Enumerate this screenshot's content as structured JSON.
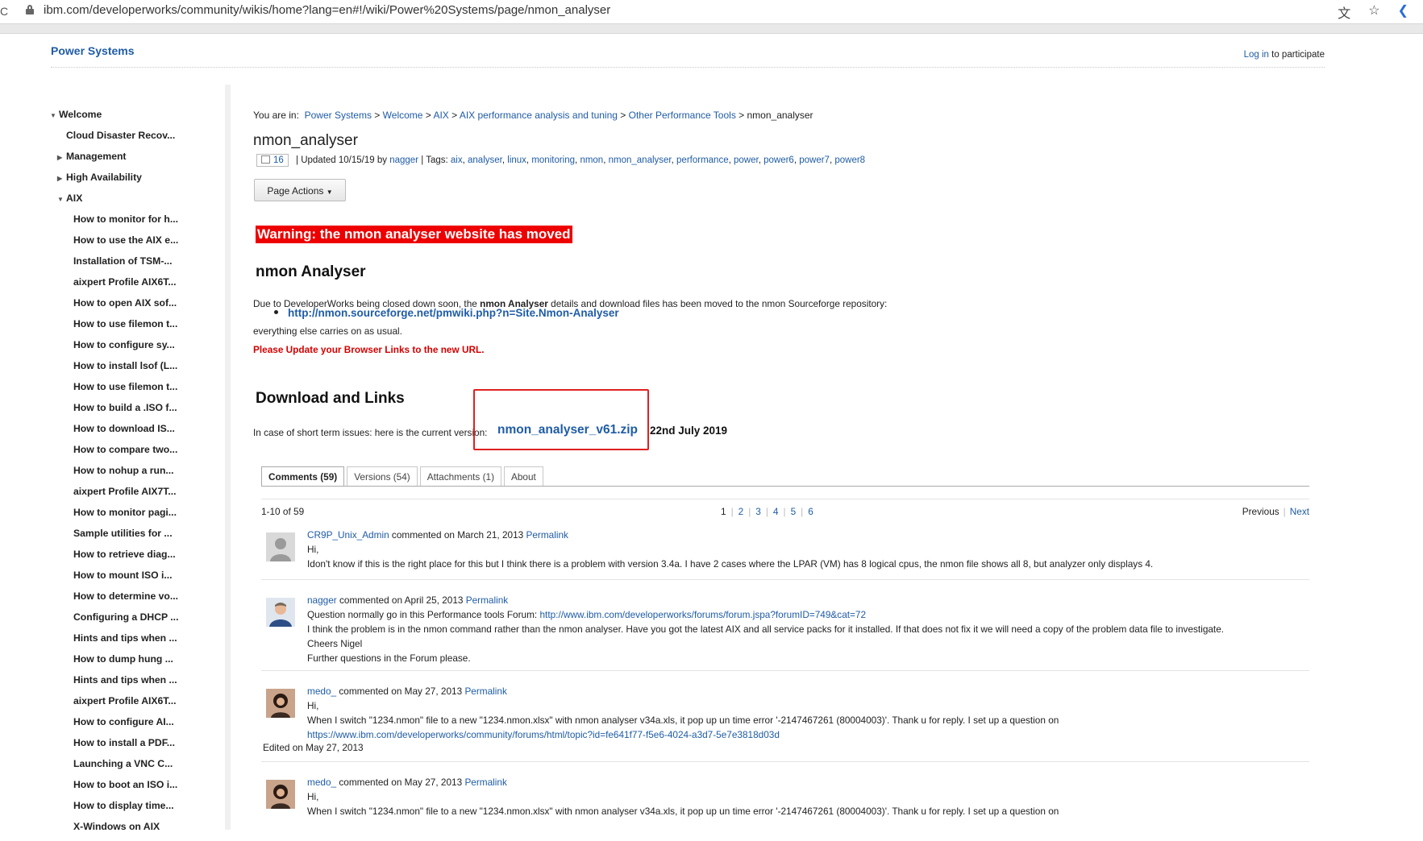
{
  "browser": {
    "url": "ibm.com/developerworks/community/wikis/home?lang=en#!/wiki/Power%20Systems/page/nmon_analyser"
  },
  "header": {
    "site_title": "Power Systems",
    "login_link": "Log in",
    "login_suffix": " to participate"
  },
  "nav": {
    "items": [
      {
        "label": "Welcome",
        "level": 0,
        "toggle": "open"
      },
      {
        "label": "Cloud Disaster Recov...",
        "level": 1,
        "toggle": "none"
      },
      {
        "label": "Management",
        "level": 1,
        "toggle": "closed"
      },
      {
        "label": "High Availability",
        "level": 1,
        "toggle": "closed"
      },
      {
        "label": "AIX",
        "level": 1,
        "toggle": "open"
      },
      {
        "label": "How to monitor for h...",
        "level": 2,
        "toggle": "none"
      },
      {
        "label": "How to use the AIX e...",
        "level": 2,
        "toggle": "none"
      },
      {
        "label": "Installation of TSM-...",
        "level": 2,
        "toggle": "none"
      },
      {
        "label": "aixpert Profile AIX6T...",
        "level": 2,
        "toggle": "none"
      },
      {
        "label": "How to open AIX sof...",
        "level": 2,
        "toggle": "none"
      },
      {
        "label": "How to use filemon t...",
        "level": 2,
        "toggle": "none"
      },
      {
        "label": "How to configure sy...",
        "level": 2,
        "toggle": "none"
      },
      {
        "label": "How to install lsof (L...",
        "level": 2,
        "toggle": "none"
      },
      {
        "label": "How to use filemon t...",
        "level": 2,
        "toggle": "none"
      },
      {
        "label": "How to build a .ISO f...",
        "level": 2,
        "toggle": "none"
      },
      {
        "label": "How to download IS...",
        "level": 2,
        "toggle": "none"
      },
      {
        "label": "How to compare two...",
        "level": 2,
        "toggle": "none"
      },
      {
        "label": "How to nohup a run...",
        "level": 2,
        "toggle": "none"
      },
      {
        "label": "aixpert Profile AIX7T...",
        "level": 2,
        "toggle": "none"
      },
      {
        "label": "How to monitor pagi...",
        "level": 2,
        "toggle": "none"
      },
      {
        "label": "Sample utilities for ...",
        "level": 2,
        "toggle": "none"
      },
      {
        "label": "How to retrieve diag...",
        "level": 2,
        "toggle": "none"
      },
      {
        "label": "How to mount ISO i...",
        "level": 2,
        "toggle": "none"
      },
      {
        "label": "How to determine vo...",
        "level": 2,
        "toggle": "none"
      },
      {
        "label": "Configuring a DHCP ...",
        "level": 2,
        "toggle": "none"
      },
      {
        "label": "Hints and tips when ...",
        "level": 2,
        "toggle": "none"
      },
      {
        "label": "How to dump hung ...",
        "level": 2,
        "toggle": "none"
      },
      {
        "label": "Hints and tips when ...",
        "level": 2,
        "toggle": "none"
      },
      {
        "label": "aixpert Profile AIX6T...",
        "level": 2,
        "toggle": "none"
      },
      {
        "label": "How to configure AI...",
        "level": 2,
        "toggle": "none"
      },
      {
        "label": "How to install a PDF...",
        "level": 2,
        "toggle": "none"
      },
      {
        "label": "Launching a VNC C...",
        "level": 2,
        "toggle": "none"
      },
      {
        "label": "How to boot an ISO i...",
        "level": 2,
        "toggle": "none"
      },
      {
        "label": "How to display time...",
        "level": 2,
        "toggle": "none"
      },
      {
        "label": "X-Windows on AIX",
        "level": 2,
        "toggle": "none"
      }
    ]
  },
  "breadcrumb": {
    "prefix": "You are in:",
    "links": [
      "Power Systems",
      "Welcome",
      "AIX",
      "AIX performance analysis and tuning",
      "Other Performance Tools"
    ],
    "current": "nmon_analyser",
    "separator": ">"
  },
  "page": {
    "title": "nmon_analyser",
    "likes": "16",
    "updated": "Updated 10/15/19 by",
    "author": "nagger",
    "tags_label": "Tags:",
    "tags": [
      "aix",
      "analyser",
      "linux",
      "monitoring",
      "nmon",
      "nmon_analyser",
      "performance",
      "power",
      "power6",
      "power7",
      "power8"
    ],
    "page_actions": "Page Actions"
  },
  "content": {
    "warning": "Warning: the nmon analyser website has moved",
    "heading1": "nmon Analyser",
    "moved_prefix": "Due to DeveloperWorks being closed down soon, the ",
    "moved_bold": "nmon Analyser",
    "moved_suffix": " details and download files has been moved to the nmon Sourceforge repository:",
    "sourceforge_link": "http://nmon.sourceforge.net/pmwiki.php?n=Site.Nmon-Analyser",
    "carries_on": "everything else carries on as usual.",
    "update_links": "Please Update your Browser Links to the new URL.",
    "heading2": "Download and Links",
    "short_term": "In case of short term issues: here is the current version:",
    "zip_link": "nmon_analyser_v61.zip",
    "zip_date": "22nd July 2019"
  },
  "tabs": [
    "Comments (59)",
    "Versions (54)",
    "Attachments (1)",
    "About"
  ],
  "pager": {
    "count": "1-10 of 59",
    "pages": [
      "1",
      "2",
      "3",
      "4",
      "5",
      "6"
    ],
    "previous": "Previous",
    "next": "Next"
  },
  "comments": [
    {
      "author": "CR9P_Unix_Admin",
      "meta": " commented on March 21, 2013 ",
      "permalink": "Permalink",
      "lines": [
        {
          "text": "Hi,"
        },
        {
          "text": "Idon't know if this is the right place for this but I think there is a problem with version 3.4a. I have 2 cases where the LPAR (VM) has 8 logical cpus, the nmon file shows all 8, but analyzer only displays 4."
        }
      ]
    },
    {
      "author": "nagger",
      "meta": " commented on April 25, 2013 ",
      "permalink": "Permalink",
      "lines": [
        {
          "text": "Question normally go in this Performance tools Forum: ",
          "link": "http://www.ibm.com/developerworks/forums/forum.jspa?forumID=749&cat=72"
        },
        {
          "text": "I think the problem is in the nmon command rather than the nmon analyser. Have you got the latest AIX and all service packs for it installed.  If that does not fix it we will need a copy of the problem data file to investigate."
        },
        {
          "text": "Cheers Nigel"
        },
        {
          "text": "Further questions in the Forum please."
        }
      ]
    },
    {
      "author": "medo_",
      "meta": " commented on May 27, 2013 ",
      "permalink": "Permalink",
      "lines": [
        {
          "text": "Hi,"
        },
        {
          "text": "When I switch \"1234.nmon\" file to a new \"1234.nmon.xlsx\" with nmon analyser v34a.xls, it pop up un time error '-2147467261 (80004003)'. Thank u for reply. I set up a question on"
        },
        {
          "text": "",
          "link": "https://www.ibm.com/developerworks/community/forums/html/topic?id=fe641f77-f5e6-4024-a3d7-5e7e3818d03d"
        }
      ],
      "edited": "Edited on May 27, 2013"
    },
    {
      "author": "medo_",
      "meta": " commented on May 27, 2013 ",
      "permalink": "Permalink",
      "lines": [
        {
          "text": "Hi,"
        },
        {
          "text": "When I switch \"1234.nmon\" file to a new \"1234.nmon.xlsx\" with nmon analyser v34a.xls, it pop up un time error '-2147467261 (80004003)'. Thank u for reply. I set up a question on"
        }
      ]
    }
  ]
}
